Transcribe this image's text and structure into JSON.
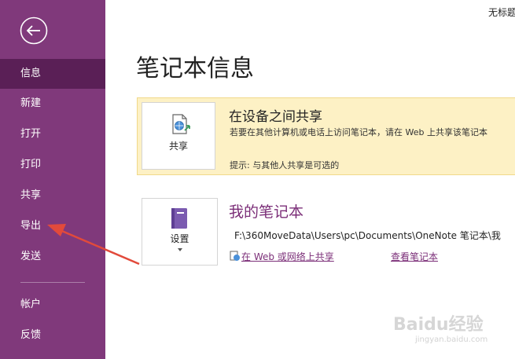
{
  "window": {
    "title": "无标题"
  },
  "sidebar": {
    "items": [
      {
        "label": "信息",
        "active": true
      },
      {
        "label": "新建"
      },
      {
        "label": "打开"
      },
      {
        "label": "打印"
      },
      {
        "label": "共享"
      },
      {
        "label": "导出"
      },
      {
        "label": "发送"
      },
      {
        "label": "帐户"
      },
      {
        "label": "反馈"
      }
    ],
    "back_icon": "back-arrow-icon"
  },
  "main": {
    "page_title": "笔记本信息",
    "share_panel": {
      "button_label": "共享",
      "heading": "在设备之间共享",
      "description": "若要在其他计算机或电话上访问笔记本，请在 Web 上共享该笔记本",
      "tip": "提示: 与其他人共享是可选的",
      "icon": "share-globe-icon"
    },
    "notebook": {
      "button_label": "设置",
      "title": "我的笔记本",
      "path": "F:\\360MoveData\\Users\\pc\\Documents\\OneNote 笔记本\\我",
      "link_share": "在 Web 或网络上共享",
      "link_view": "查看笔记本",
      "icon": "notebook-icon"
    }
  },
  "watermark": {
    "brand": "Baidu经验",
    "url": "jingyan.baidu.com"
  },
  "colors": {
    "sidebar_bg": "#80397b",
    "sidebar_active": "#5a1f56",
    "accent": "#7b2e78",
    "share_panel_bg": "#fdf1c5",
    "annotation_arrow": "#e24a3b"
  }
}
